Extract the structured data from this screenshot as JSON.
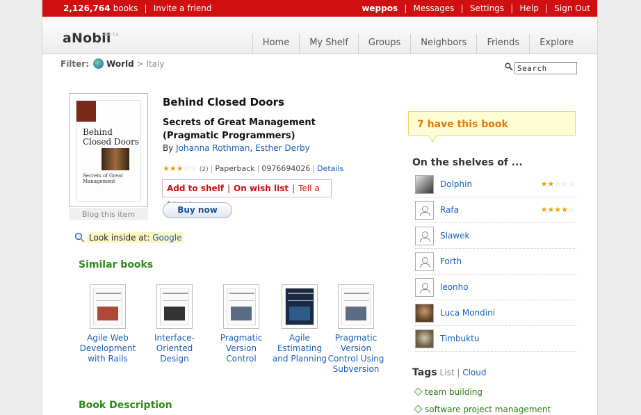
{
  "topbar": {
    "books_count": "2,126,764",
    "books_label": "books",
    "invite": "Invite a friend",
    "user": "weppos",
    "links": [
      "Messages",
      "Settings",
      "Help",
      "Sign Out"
    ]
  },
  "header": {
    "logo": "aNobii",
    "beta": "BETA",
    "nav": [
      "Home",
      "My Shelf",
      "Groups",
      "Neighbors",
      "Friends",
      "Explore"
    ]
  },
  "filter": {
    "label": "Filter:",
    "world": "World",
    "arrow": ">",
    "country": "Italy"
  },
  "search": {
    "value": "Search"
  },
  "book": {
    "cover_title": "Behind Closed Doors",
    "cover_subtitle": "Secrets of Great Management",
    "blog": "Blog this item",
    "title": "Behind Closed Doors",
    "subtitle": "Secrets of Great Management (Pragmatic Programmers)",
    "by": "By",
    "author1": "Johanna Rothman",
    "author2": "Esther Derby",
    "rating": 3,
    "rating_max": 5,
    "rating_count": "(2)",
    "format": "Paperback",
    "isbn": "0976694026",
    "details": "Details",
    "add_to_shelf": "Add to shelf",
    "on_wish_list": "On wish list",
    "tell_friend": "Tell a friend",
    "buy_now": "Buy now",
    "look_inside_label": "Look inside at:",
    "look_inside_link": "Google"
  },
  "similar": {
    "heading": "Similar books",
    "items": [
      {
        "title": "Agile Web Development with Rails"
      },
      {
        "title": "Interface-Oriented Design"
      },
      {
        "title": "Pragmatic Version Control"
      },
      {
        "title": "Agile Estimating and Planning"
      },
      {
        "title": "Pragmatic Version Control Using Subversion"
      }
    ]
  },
  "description_heading": "Book Description",
  "sidebar": {
    "have_count": "7 have this book",
    "shelves_heading": "On the shelves of ...",
    "users": [
      {
        "name": "Dolphin",
        "rating": 2
      },
      {
        "name": "Rafa",
        "rating": 4
      },
      {
        "name": "Slawek",
        "rating": 0
      },
      {
        "name": "Forth",
        "rating": 0
      },
      {
        "name": "leonho",
        "rating": 0
      },
      {
        "name": "Luca Mondini",
        "rating": 0
      },
      {
        "name": "Timbuktu",
        "rating": 0
      }
    ],
    "tags_heading": "Tags",
    "tags_list": "List",
    "tags_cloud": "Cloud",
    "tags": [
      "team building",
      "software project management"
    ]
  },
  "colors": {
    "topbar": "#d01010",
    "link": "#1a5fb4",
    "heading_green": "#2e8b1a",
    "bubble_text": "#e87800",
    "star": "#e8a000"
  }
}
